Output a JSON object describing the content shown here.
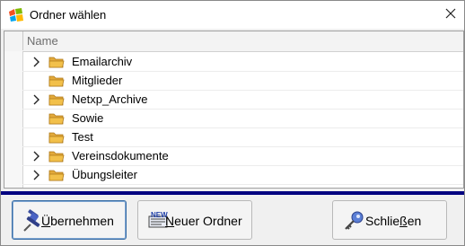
{
  "window": {
    "title": "Ordner wählen"
  },
  "icons": {
    "title": "windows-logo-icon",
    "close": "close-icon",
    "expander": "chevron-right-icon",
    "folder": "folder-icon",
    "accept": "pushpin-icon",
    "new_folder": "new-folder-icon",
    "close_button": "key-icon"
  },
  "tree": {
    "column_header": "Name",
    "items": [
      {
        "label": "Emailarchiv",
        "expandable": true
      },
      {
        "label": "Mitglieder",
        "expandable": false
      },
      {
        "label": "Netxp_Archive",
        "expandable": true
      },
      {
        "label": "Sowie",
        "expandable": false
      },
      {
        "label": "Test",
        "expandable": false
      },
      {
        "label": "Vereinsdokumente",
        "expandable": true
      },
      {
        "label": "Übungsleiter",
        "expandable": true
      }
    ]
  },
  "buttons": {
    "accept": {
      "pre": "",
      "mnemonic": "Ü",
      "post": "bernehmen"
    },
    "new_folder": {
      "pre": "",
      "mnemonic": "N",
      "post": "euer Ordner"
    },
    "close": {
      "pre": "Schlie",
      "mnemonic": "ß",
      "post": "en"
    }
  },
  "colors": {
    "accent_bar": "#000080",
    "folder": "#f2c04a",
    "default_button_border": "#3a6ea5"
  }
}
